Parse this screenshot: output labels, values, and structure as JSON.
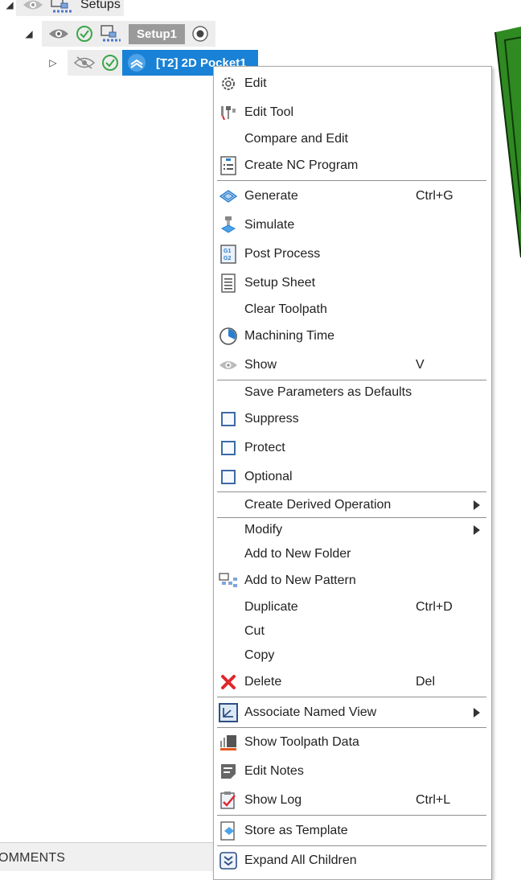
{
  "tree": {
    "setups_label": "Setups",
    "setup1_label": "Setup1",
    "operation_label": "[T2] 2D Pocket1"
  },
  "comments": {
    "label": "OMMENTS"
  },
  "context_menu": {
    "items": {
      "edit": {
        "label": "Edit",
        "icon": "gear-icon"
      },
      "edit_tool": {
        "label": "Edit Tool",
        "icon": "tool-icon"
      },
      "compare_and_edit": {
        "label": "Compare and Edit"
      },
      "create_nc_program": {
        "label": "Create NC Program",
        "icon": "nc-program-icon"
      },
      "generate": {
        "label": "Generate",
        "shortcut": "Ctrl+G",
        "icon": "generate-icon"
      },
      "simulate": {
        "label": "Simulate",
        "icon": "simulate-icon"
      },
      "post_process": {
        "label": "Post Process",
        "icon": "post-process-icon"
      },
      "setup_sheet": {
        "label": "Setup Sheet",
        "icon": "setup-sheet-icon"
      },
      "clear_toolpath": {
        "label": "Clear Toolpath"
      },
      "machining_time": {
        "label": "Machining Time",
        "icon": "clock-icon"
      },
      "show": {
        "label": "Show",
        "shortcut": "V",
        "icon": "eye-icon"
      },
      "save_parameters": {
        "label": "Save Parameters as Defaults"
      },
      "suppress": {
        "label": "Suppress"
      },
      "protect": {
        "label": "Protect"
      },
      "optional": {
        "label": "Optional"
      },
      "create_derived": {
        "label": "Create Derived Operation"
      },
      "modify": {
        "label": "Modify"
      },
      "add_to_new_folder": {
        "label": "Add to New Folder"
      },
      "add_to_new_pattern": {
        "label": "Add to New Pattern",
        "icon": "pattern-icon"
      },
      "duplicate": {
        "label": "Duplicate",
        "shortcut": "Ctrl+D"
      },
      "cut": {
        "label": "Cut"
      },
      "copy": {
        "label": "Copy"
      },
      "delete": {
        "label": "Delete",
        "shortcut": "Del",
        "icon": "delete-icon"
      },
      "associate_named_view": {
        "label": "Associate Named View",
        "icon": "named-view-icon"
      },
      "show_toolpath_data": {
        "label": "Show Toolpath Data",
        "icon": "toolpath-data-icon"
      },
      "edit_notes": {
        "label": "Edit Notes",
        "icon": "notes-icon"
      },
      "show_log": {
        "label": "Show Log",
        "shortcut": "Ctrl+L",
        "icon": "log-icon"
      },
      "store_as_template": {
        "label": "Store as Template",
        "icon": "template-icon"
      },
      "expand_all_children": {
        "label": "Expand All Children",
        "icon": "expand-icon"
      }
    }
  },
  "colors": {
    "selection_blue": "#1a82d6",
    "setup_chip_gray": "#9a9a9a",
    "check_green": "#3aa64a",
    "delete_red": "#e0262b",
    "model_green": "#2f8a22"
  }
}
